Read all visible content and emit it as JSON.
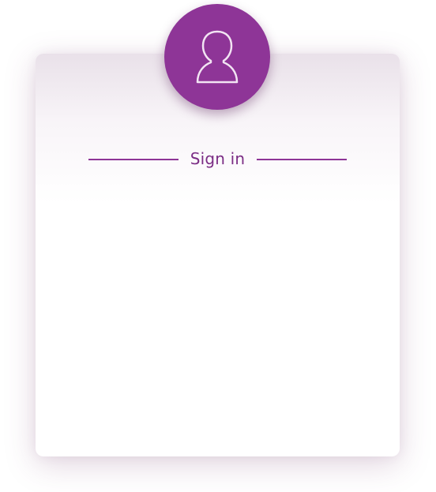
{
  "signin_card": {
    "heading": "Sign in"
  },
  "avatar": {
    "icon": "user-icon"
  },
  "colors": {
    "accent": "#8e3597",
    "heading_text": "#7b2d85",
    "background": "#ffffff"
  }
}
